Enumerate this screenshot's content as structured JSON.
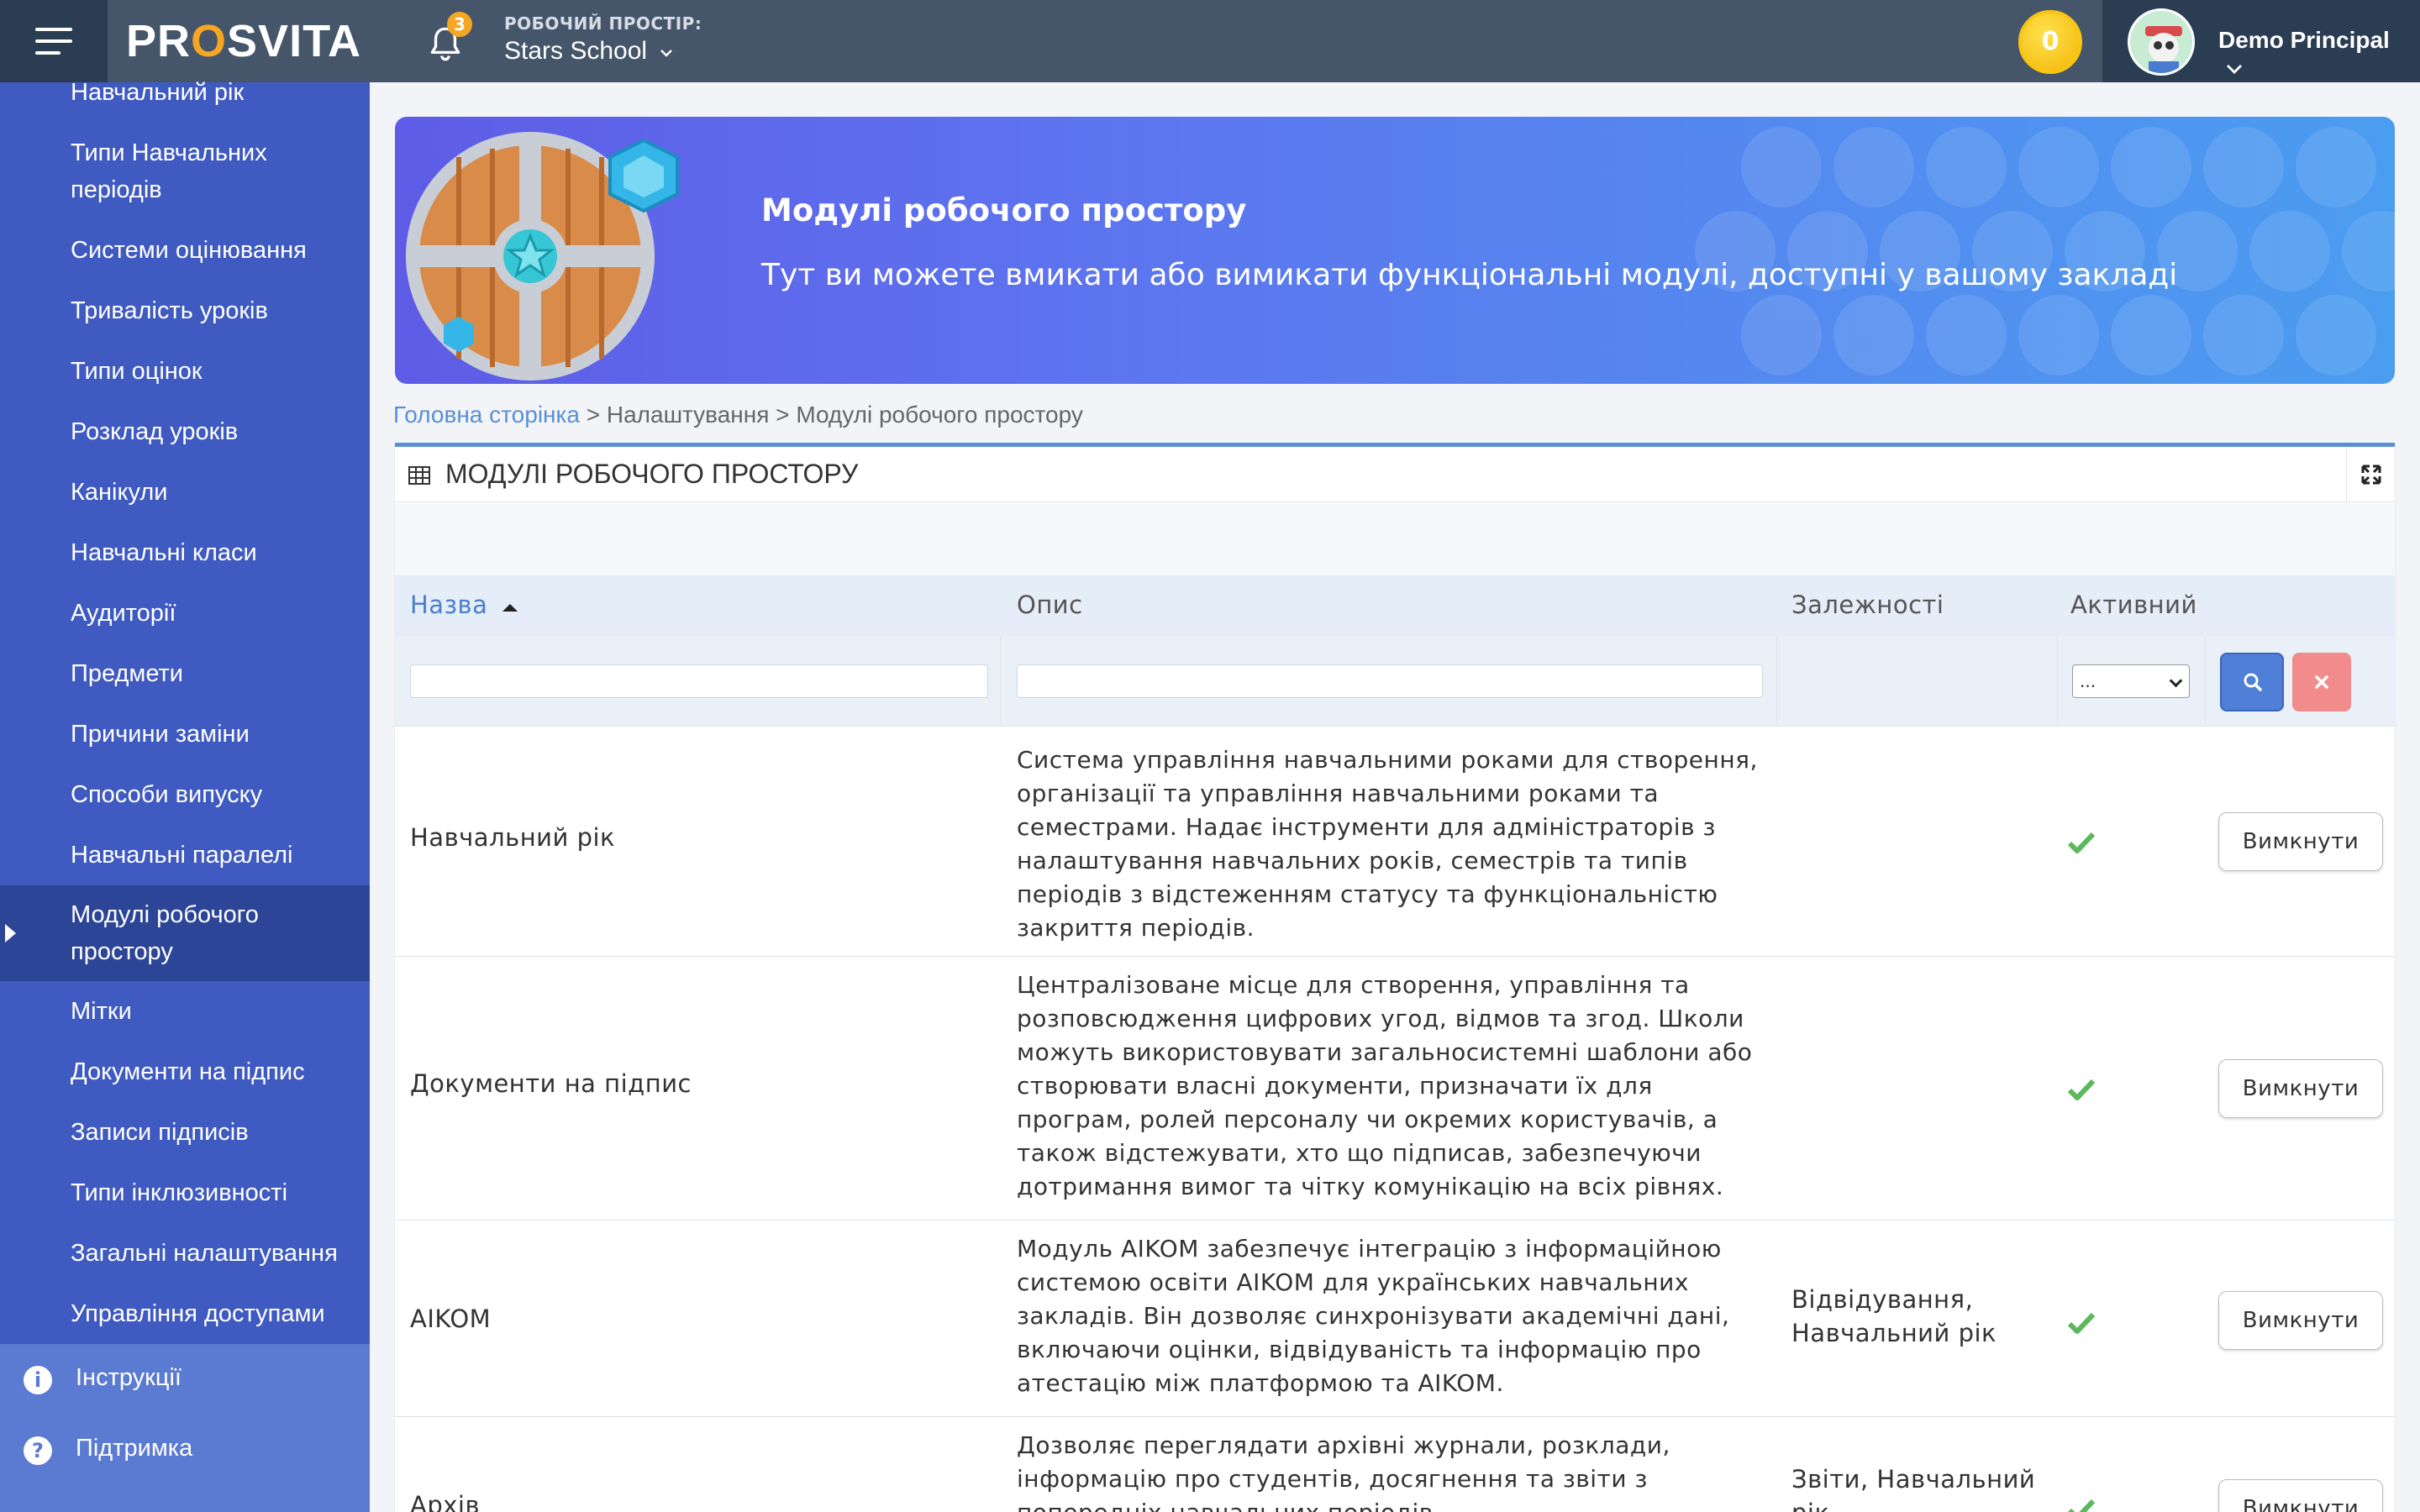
{
  "header": {
    "logo": "PROSVITA",
    "notifications_count": "3",
    "workspace_label": "РОБОЧИЙ ПРОСТІР:",
    "workspace_name": "Stars School",
    "coins": "0",
    "user_name": "Demo Principal"
  },
  "sidebar": {
    "items": [
      {
        "label": "Навчальний рік"
      },
      {
        "label": "Типи Навчальних періодів"
      },
      {
        "label": "Системи оцінювання"
      },
      {
        "label": "Тривалість уроків"
      },
      {
        "label": "Типи оцінок"
      },
      {
        "label": "Розклад уроків"
      },
      {
        "label": "Канікули"
      },
      {
        "label": "Навчальні класи"
      },
      {
        "label": "Аудиторії"
      },
      {
        "label": "Предмети"
      },
      {
        "label": "Причини заміни"
      },
      {
        "label": "Способи випуску"
      },
      {
        "label": "Навчальні паралелі"
      },
      {
        "label": "Модулі робочого простору"
      },
      {
        "label": "Мітки"
      },
      {
        "label": "Документи на підпис"
      },
      {
        "label": "Записи підписів"
      },
      {
        "label": "Типи інклюзивності"
      },
      {
        "label": "Загальні налаштування"
      },
      {
        "label": "Управління доступами"
      }
    ],
    "active_index": 13,
    "bottom": [
      {
        "label": "Інструкції",
        "icon": "info-icon"
      },
      {
        "label": "Підтримка",
        "icon": "question-icon"
      }
    ]
  },
  "banner": {
    "title": "Модулі робочого простору",
    "subtitle": "Тут ви можете вмикати або вимикати функціональні модулі, доступні у вашому закладі"
  },
  "breadcrumb": {
    "home": "Головна сторінка",
    "sep1": " > ",
    "settings": "Налаштування",
    "sep2": " > ",
    "current": "Модулі робочого простору"
  },
  "panel": {
    "title": "МОДУЛІ РОБОЧОГО ПРОСТОРУ",
    "columns": {
      "name": "Назва",
      "description": "Опис",
      "dependencies": "Залежності",
      "active": "Активний"
    },
    "filter_active_value": "...",
    "rows": [
      {
        "name": "Навчальний рік",
        "description": "Система управління навчальними роками для створення, організації та управління навчальними роками та семестрами. Надає інструменти для адміністраторів з налаштування навчальних років, семестрів та типів періодів з відстеженням статусу та функціональністю закриття періодів.",
        "dependencies": "",
        "active": true,
        "action": "Вимкнути"
      },
      {
        "name": "Документи на підпис",
        "description": "Централізоване місце для створення, управління та розповсюдження цифрових угод, відмов та згод. Школи можуть використовувати загальносистемні шаблони або створювати власні документи, призначати їх для програм, ролей персоналу чи окремих користувачів, а також відстежувати, хто що підписав, забезпечуючи дотримання вимог та чітку комунікацію на всіх рівнях.",
        "dependencies": "",
        "active": true,
        "action": "Вимкнути"
      },
      {
        "name": "AIKOM",
        "description": "Модуль AIKOM забезпечує інтеграцію з інформаційною системою освіти AIKOM для українських навчальних закладів. Він дозволяє синхронізувати академічні дані, включаючи оцінки, відвідуваність та інформацію про атестацію між платформою та AIKOM.",
        "dependencies": "Відвідування, Навчальний рік",
        "active": true,
        "action": "Вимкнути"
      },
      {
        "name": "Архів",
        "description": "Дозволяє переглядати архівні журнали, розклади, інформацію про студентів, досягнення та звіти з попередніх навчальних періодів.",
        "dependencies": "Звіти, Навчальний рік",
        "active": true,
        "action": "Вимкнути"
      }
    ]
  }
}
